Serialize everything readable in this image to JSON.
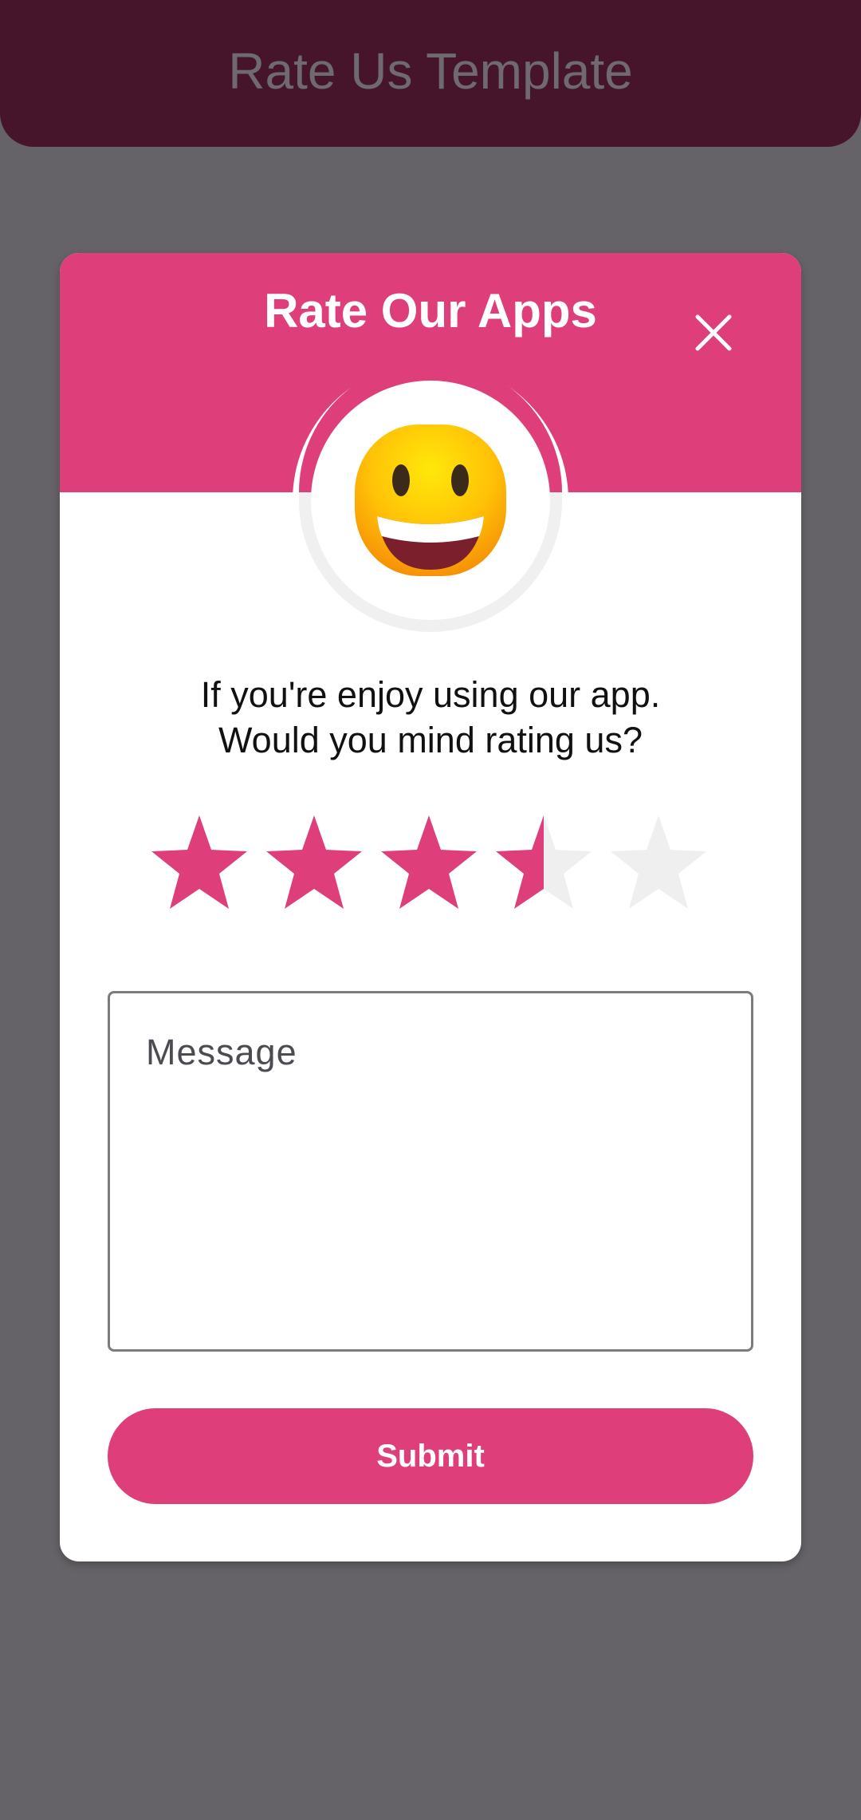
{
  "app_bar": {
    "title": "Rate Us Template"
  },
  "dialog": {
    "title": "Rate Our Apps",
    "prompt_line1": "If you're enjoy using our app.",
    "prompt_line2": "Would you mind rating us?",
    "rating": {
      "value": 3.5,
      "max": 5
    },
    "message": {
      "placeholder": "Message",
      "value": ""
    },
    "submit_label": "Submit"
  },
  "icons": {
    "close": "close-icon",
    "emoji": "grinning-face-emoji-icon",
    "star": "star-icon"
  },
  "colors": {
    "accent": "#de3f7a",
    "app_bar": "#46152b",
    "scrim": "#656367",
    "star_empty": "#efefef"
  }
}
